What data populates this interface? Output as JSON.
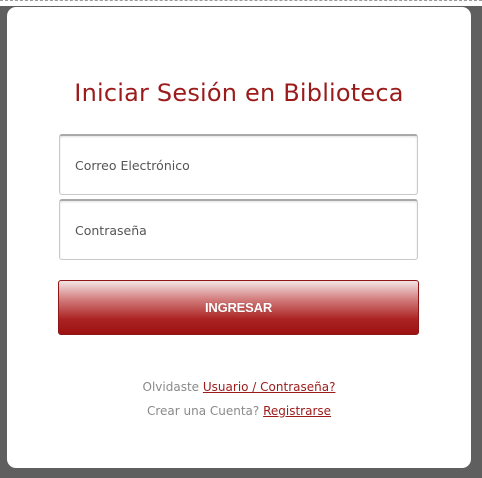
{
  "login": {
    "title": "Iniciar Sesión en Biblioteca",
    "email_placeholder": "Correo Electrónico",
    "email_value": "",
    "password_placeholder": "Contraseña",
    "password_value": "",
    "submit_label": "INGRESAR",
    "forgot_prefix": "Olvidaste",
    "forgot_link": "Usuario / Contraseña?",
    "register_prefix": "Crear una Cuenta?",
    "register_link": "Registrarse"
  },
  "colors": {
    "title": "#9b1b1b",
    "button_bottom": "#9c1212",
    "link": "#9b1b1b",
    "muted_text": "#8a8a8a",
    "backdrop": "#5f5f5f"
  }
}
